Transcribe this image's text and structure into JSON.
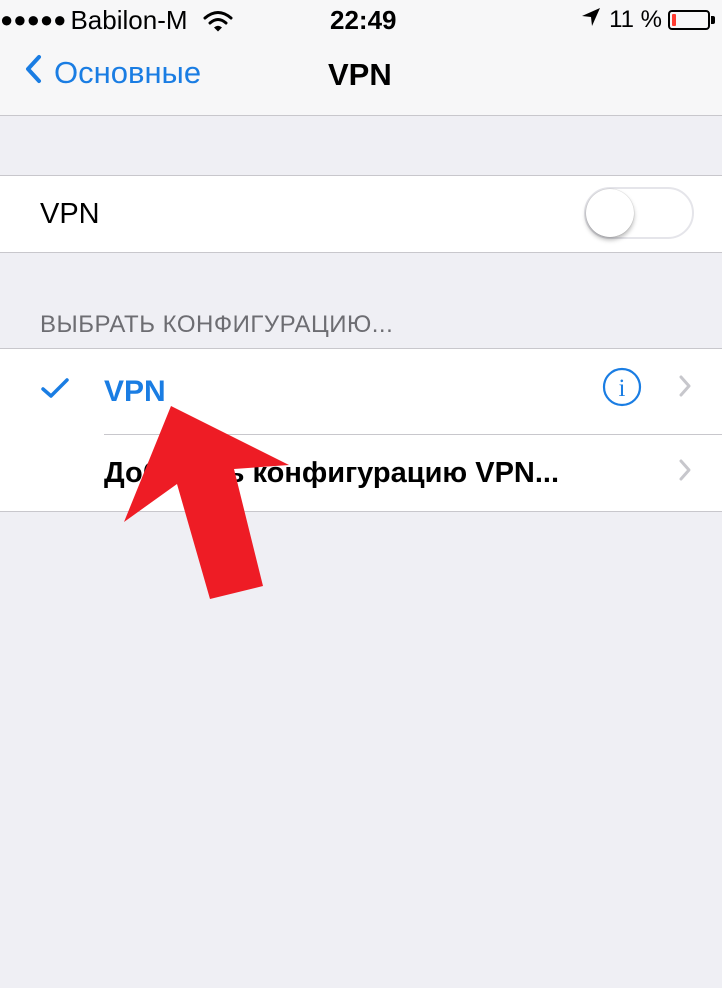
{
  "status_bar": {
    "signal_dots": "●●●●●",
    "carrier": "Babilon-M",
    "time": "22:49",
    "battery_percent": "11 %",
    "battery_level": 0.11,
    "icons": [
      "wifi-icon",
      "location-icon",
      "battery-icon"
    ]
  },
  "nav": {
    "back_label": "Основные",
    "title": "VPN"
  },
  "vpn_toggle": {
    "label": "VPN",
    "on": false
  },
  "config_section": {
    "header": "ВЫБРАТЬ КОНФИГУРАЦИЮ...",
    "items": [
      {
        "label": "VPN",
        "selected": true
      },
      {
        "label": "Добавить конфигурацию VPN..."
      }
    ]
  },
  "colors": {
    "accent": "#1a7de3",
    "background": "#efeff4",
    "arrow": "#ee1c25",
    "battery_low": "#ff3b30"
  }
}
